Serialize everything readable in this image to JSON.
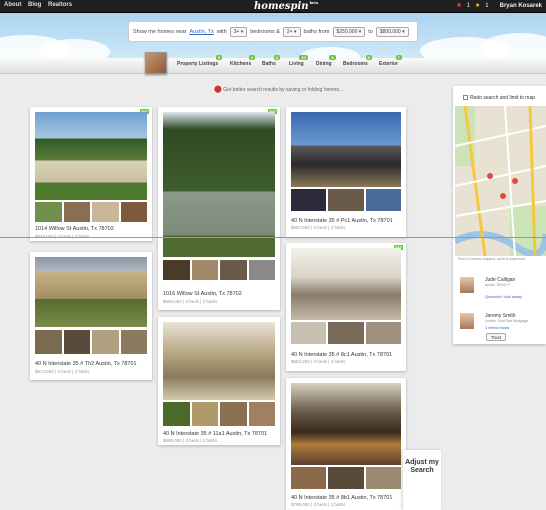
{
  "topbar": {
    "links": [
      "About",
      "Blog",
      "Realtors"
    ],
    "logo": "homespin",
    "logo_badge": "beta",
    "alerts_count": "1",
    "favorites_count": "1",
    "user_name": "Bryan Kosarek"
  },
  "search": {
    "prefix": "Show me homes near",
    "location": "Austin, Tx",
    "with_label": "with",
    "bedrooms_value": "3+",
    "bedrooms_label": "bedrooms &",
    "baths_value": "2+",
    "baths_label": "baths from",
    "price_min": "$250,000",
    "to_label": "to",
    "price_max": "$800,000"
  },
  "tabs": [
    {
      "label": "Property Listings",
      "count": "5"
    },
    {
      "label": "Kitchens",
      "count": "2"
    },
    {
      "label": "Baths",
      "count": "4"
    },
    {
      "label": "Living",
      "count": "10"
    },
    {
      "label": "Dining",
      "count": "3"
    },
    {
      "label": "Bedrooms",
      "count": "8"
    },
    {
      "label": "Exterior",
      "count": "7"
    }
  ],
  "hint": "Get better search results by saving or folding homes...",
  "listings": [
    {
      "address": "1014 Willow St Austin, Tx 78702",
      "meta": "$649,000 | 3 beds | 2 baths",
      "new": true
    },
    {
      "address": "40 N Interstate 35 # Th2 Austin, Tx 78701",
      "meta": "$674,500 | 3 beds | 3 baths",
      "new": false
    },
    {
      "address": "1016 Willow St Austin, Tx 78702",
      "meta": "$665,000 | 3 beds | 2 baths",
      "new": true
    },
    {
      "address": "40 N Interstate 35 # 11a1 Austin, Tx 78701",
      "meta": "$699,000 | 3 beds | 2 baths",
      "new": false
    },
    {
      "address": "40 N Interstate 35 # Pc1 Austin, Tx 78701",
      "meta": "$587,500 | 3 beds | 3 baths",
      "new": false
    },
    {
      "address": "40 N Interstate 35 # 8c1 Austin, Tx 78701",
      "meta": "$683,250 | 3 beds | 3 baths",
      "new": true
    },
    {
      "address": "40 N Interstate 35 # 8b1 Austin, Tx 78701",
      "meta": "$799,000 | 3 beds | 3 baths",
      "new": false
    }
  ],
  "map": {
    "redo_label": "Redo search and limit to map",
    "footer": "Find 12 homes mapped, scroll to load more"
  },
  "agents": [
    {
      "name": "Jude Calligan",
      "subtitle": "Austin, REALTY",
      "ask": "Question? Ask away!"
    },
    {
      "name": "Jeremy Smith",
      "subtitle": "Lender, Gold Star Mortgage",
      "ask": "1 friend trusts"
    }
  ],
  "trust_button": "Trust",
  "adjust_button": "Adjust my Search",
  "colors": {
    "accent_green": "#66cc33",
    "link_blue": "#3366cc",
    "topbar": "#1f1f1f"
  }
}
